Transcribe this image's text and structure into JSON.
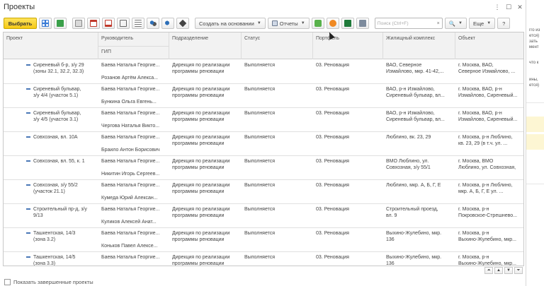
{
  "window": {
    "title": "Проекты"
  },
  "toolbar": {
    "select_label": "Выбрать",
    "create_based_label": "Создать на основании",
    "reports_label": "Отчеты",
    "search_placeholder": "Поиск (Ctrl+F)",
    "search_clear": "×",
    "more_label": "Еще",
    "help_label": "?"
  },
  "columns": {
    "project": "Проект",
    "manager": "Руководитель",
    "gip": "ГИП",
    "department": "Подразделение",
    "status": "Статус",
    "portfolio": "Портфель",
    "complex": "Жилищный комплекс",
    "object": "Объект"
  },
  "rows": [
    {
      "project": [
        "Сиреневый б-р, з/у 29",
        "(зоны 32.1, 32.2, 32.3)"
      ],
      "manager": "Баева Наталья Георгие...",
      "gip": "Розанов Артём Алекса...",
      "department": [
        "Дирекция по реализации",
        "программы реновации"
      ],
      "status": "Выполняется",
      "portfolio": "03. Реновация",
      "complex": [
        "ВАО, Северное",
        "Измайлово, мкр. 41-42,..."
      ],
      "object": [
        "г. Москва, ВАО,",
        "Северное Измайлово, ..."
      ]
    },
    {
      "project": [
        "Сиреневый бульвар,",
        "з/у 4/4 (участок 5.1)"
      ],
      "manager": "Баева Наталья Георгие...",
      "gip": "Бункина Ольга Евгень...",
      "department": [
        "Дирекция по реализации",
        "программы реновации"
      ],
      "status": "Выполняется",
      "portfolio": "03. Реновация",
      "complex": [
        "ВАО, р-н Измайлово,",
        "Сиреневый бульвар, вл..."
      ],
      "object": [
        "г. Москва, ВАО, р-н",
        "Измайлово, Сиреневый..."
      ]
    },
    {
      "project": [
        "Сиреневый бульвар,",
        "з/у 4/5 (участок 3.1)"
      ],
      "manager": "Баева Наталья Георгие...",
      "gip": "Чергова Наталья Викто...",
      "department": [
        "Дирекция по реализации",
        "программы реновации"
      ],
      "status": "Выполняется",
      "portfolio": "03. Реновация",
      "complex": [
        "ВАО, р-н Измайлово,",
        "Сиреневый бульвар, вл..."
      ],
      "object": [
        "г. Москва, ВАО, р-н",
        "Измайлово, Сиреневый..."
      ]
    },
    {
      "project": [
        "Совхозная, вл. 10А",
        ""
      ],
      "manager": "Баева Наталья Георгие...",
      "gip": "Браило Антон Борисович",
      "department": [
        "Дирекция по реализации",
        "программы реновации"
      ],
      "status": "Выполняется",
      "portfolio": "03. Реновация",
      "complex": [
        "Люблино, вк. 23, 29",
        ""
      ],
      "object": [
        "г. Москва, р-н Люблино,",
        "кв. 23, 29 (в т.ч. ул. ..."
      ]
    },
    {
      "project": [
        "Совхозная, вл. 55, к. 1",
        ""
      ],
      "manager": "Баева Наталья Георгие...",
      "gip": "Никитин Игорь Сергеев...",
      "department": [
        "Дирекция по реализации",
        "программы реновации"
      ],
      "status": "Выполняется",
      "portfolio": "03. Реновация",
      "complex": [
        "ВМО Люблино, ул.",
        "Совхозная, з/у 55/1"
      ],
      "object": [
        "г. Москва, ВМО",
        "Люблино, ул. Совхозная,"
      ]
    },
    {
      "project": [
        "Совхозная, з/у 55/2",
        "(участок 21.1)"
      ],
      "manager": "Баева Наталья Георгие...",
      "gip": "Кумеда Юрий Алексан...",
      "department": [
        "Дирекция по реализации",
        "программы реновации"
      ],
      "status": "Выполняется",
      "portfolio": "03. Реновация",
      "complex": [
        "Люблино, мкр. А, Б, Г, Е",
        ""
      ],
      "object": [
        "г. Москва, р-н Люблино,",
        "мкр. А, Б, Г, Е ул. ..."
      ]
    },
    {
      "project": [
        "Строительный пр-д, з/у",
        "9/13"
      ],
      "manager": "Баева Наталья Георгие...",
      "gip": "Куликов Алексей Анат...",
      "department": [
        "Дирекция по реализации",
        "программы реновации"
      ],
      "status": "Выполняется",
      "portfolio": "03. Реновация",
      "complex": [
        "Строительный проезд,",
        "вл. 9"
      ],
      "object": [
        "г. Москва, р-н",
        "Покровское-Стрешнево..."
      ]
    },
    {
      "project": [
        "Ташкентская, 14/3",
        "(зона 3.2)"
      ],
      "manager": "Баева Наталья Георгие...",
      "gip": "Коньков Павел Алексе...",
      "department": [
        "Дирекция по реализации",
        "программы реновации"
      ],
      "status": "Выполняется",
      "portfolio": "03. Реновация",
      "complex": [
        "Выхино-Жулебино, мкр.",
        "136"
      ],
      "object": [
        "г. Москва, р-н",
        "Выхино-Жулебино, мкр..."
      ]
    },
    {
      "project": [
        "Ташкентская, 14/5",
        "(зона 3.3)"
      ],
      "manager": "Баева Наталья Георгие...",
      "gip": "",
      "department": [
        "Дирекция по реализации",
        "программы реновации"
      ],
      "status": "Выполняется",
      "portfolio": "03. Реновация",
      "complex": [
        "Выхино-Жулебино, мкр.",
        "136"
      ],
      "object": [
        "г. Москва, р-н",
        "Выхино-Жулебино, мкр..."
      ]
    }
  ],
  "footer": {
    "show_completed_label": "Показать завершенные проекты"
  },
  "background_window": {
    "lines": [
      "гго из",
      "ется)",
      "зать",
      "мент",
      "что к",
      "ины,",
      "ется)"
    ]
  },
  "colors": {
    "accent": "#f6c915",
    "link": "#4a78b7"
  }
}
